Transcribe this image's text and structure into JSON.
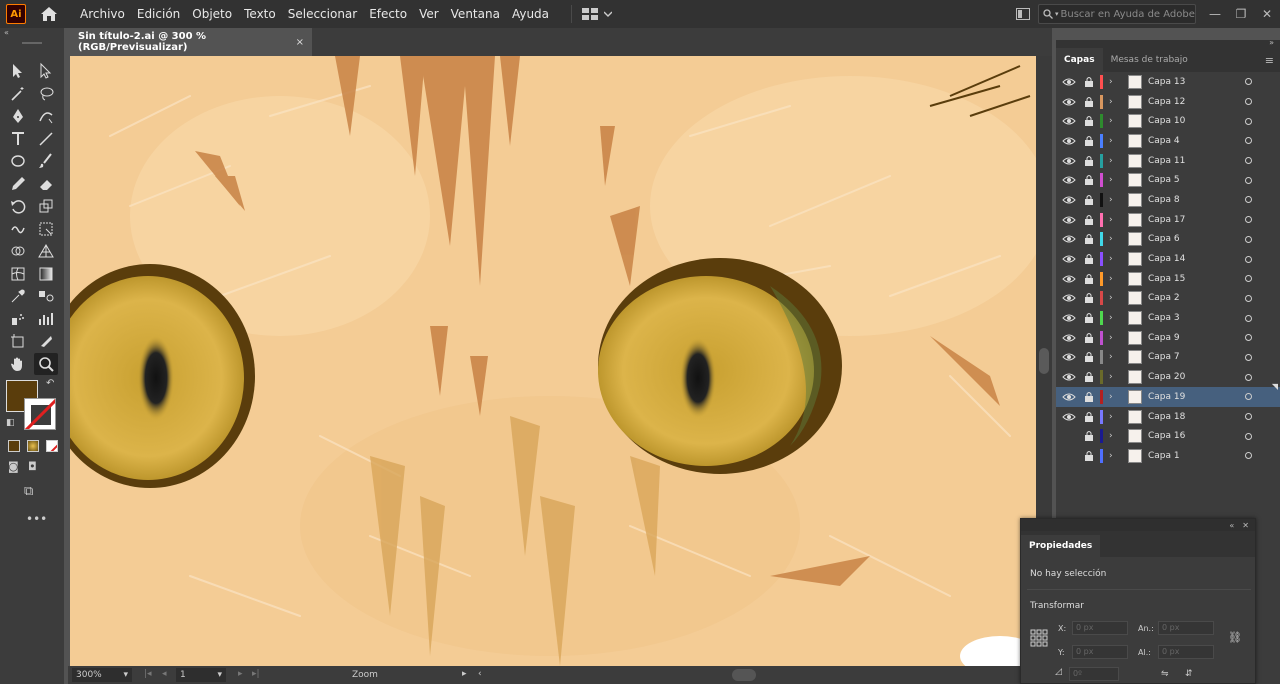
{
  "app": {
    "logo": "Ai"
  },
  "menu": [
    "Archivo",
    "Edición",
    "Objeto",
    "Texto",
    "Seleccionar",
    "Efecto",
    "Ver",
    "Ventana",
    "Ayuda"
  ],
  "search": {
    "placeholder": "Buscar en Ayuda de Adobe"
  },
  "document": {
    "tab_title": "Sin título-2.ai @ 300 % (RGB/Previsualizar)",
    "close": "×"
  },
  "tools": [
    "selection-tool",
    "direct-selection-tool",
    "magic-wand-tool",
    "lasso-tool",
    "pen-tool",
    "curvature-tool",
    "type-tool",
    "line-tool",
    "ellipse-tool",
    "paintbrush-tool",
    "pencil-tool",
    "eraser-tool",
    "rotate-tool",
    "scale-tool",
    "warp-tool",
    "free-transform-tool",
    "shape-builder-tool",
    "perspective-grid-tool",
    "mesh-tool",
    "gradient-tool",
    "eyedropper-tool",
    "blend-tool",
    "symbol-sprayer-tool",
    "column-graph-tool",
    "artboard-tool",
    "slice-tool",
    "hand-tool",
    "zoom-tool"
  ],
  "colors": {
    "fill": "#5a3d0c",
    "accent": "#46607e",
    "canvas_bg": "#f4cc95"
  },
  "status": {
    "zoom": "300%",
    "artboard": "1",
    "tool_name": "Zoom"
  },
  "layers_panel": {
    "tabs": [
      "Capas",
      "Mesas de trabajo"
    ],
    "layers": [
      {
        "name": "Capa 13",
        "color": "#ff4f4f",
        "visible": true
      },
      {
        "name": "Capa 12",
        "color": "#d8975f",
        "visible": true
      },
      {
        "name": "Capa 10",
        "color": "#2e8b2e",
        "visible": true
      },
      {
        "name": "Capa 4",
        "color": "#4a7fff",
        "visible": true
      },
      {
        "name": "Capa 11",
        "color": "#26a0a0",
        "visible": true
      },
      {
        "name": "Capa 5",
        "color": "#d04ed0",
        "visible": true
      },
      {
        "name": "Capa 8",
        "color": "#111111",
        "visible": true
      },
      {
        "name": "Capa 17",
        "color": "#ff6fb0",
        "visible": true
      },
      {
        "name": "Capa 6",
        "color": "#40d8e8",
        "visible": true
      },
      {
        "name": "Capa 14",
        "color": "#8a4fff",
        "visible": true
      },
      {
        "name": "Capa 15",
        "color": "#ff9a2a",
        "visible": true
      },
      {
        "name": "Capa 2",
        "color": "#d84848",
        "visible": true
      },
      {
        "name": "Capa 3",
        "color": "#4fd84f",
        "visible": true
      },
      {
        "name": "Capa 9",
        "color": "#c050d0",
        "visible": true
      },
      {
        "name": "Capa 7",
        "color": "#888888",
        "visible": true
      },
      {
        "name": "Capa 20",
        "color": "#6a6a2a",
        "visible": true
      },
      {
        "name": "Capa 19",
        "color": "#b42020",
        "visible": true
      },
      {
        "name": "Capa 18",
        "color": "#7878ff",
        "visible": true
      },
      {
        "name": "Capa 16",
        "color": "#1a1a90",
        "visible": false
      },
      {
        "name": "Capa 1",
        "color": "#4f6fff",
        "visible": false
      }
    ]
  },
  "properties": {
    "tab": "Propiedades",
    "selection": "No hay selección",
    "section": "Transformar",
    "x_label": "X:",
    "y_label": "Y:",
    "w_label": "An.:",
    "h_label": "Al.:",
    "x_val": "0 px",
    "y_val": "0 px",
    "w_val": "0 px",
    "h_val": "0 px",
    "angle_val": "0º"
  }
}
